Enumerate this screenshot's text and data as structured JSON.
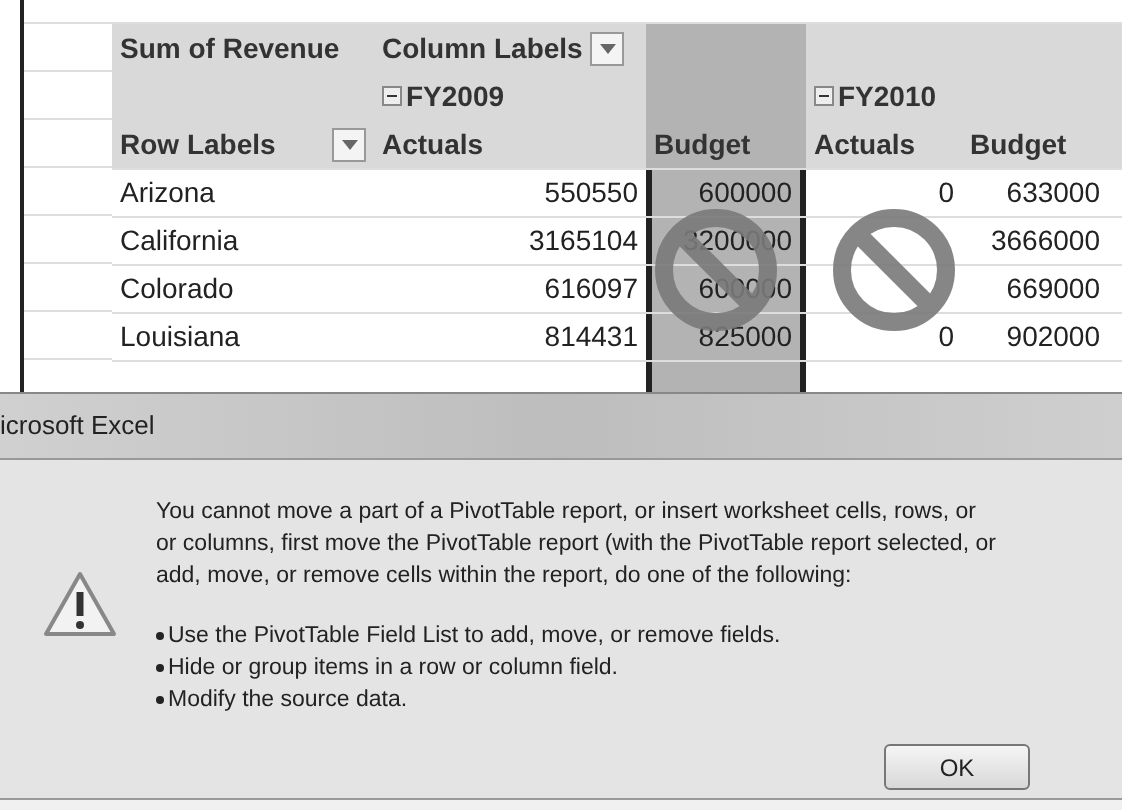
{
  "pivot": {
    "value_label": "Sum of Revenue",
    "column_labels": "Column Labels",
    "row_labels": "Row Labels",
    "years": [
      {
        "label": "FY2009",
        "expanded": true
      },
      {
        "label": "FY2010",
        "expanded": true
      }
    ],
    "measures": [
      {
        "label": "Actuals",
        "selected": false
      },
      {
        "label": "Budget",
        "selected": true
      },
      {
        "label": "Actuals",
        "selected": false
      },
      {
        "label": "Budget",
        "selected": false
      }
    ],
    "rows": [
      {
        "label": "Arizona",
        "fy2009_actuals": "550550",
        "fy2009_budget": "600000",
        "fy2010_actuals": "0",
        "fy2010_budget": "633000"
      },
      {
        "label": "California",
        "fy2009_actuals": "3165104",
        "fy2009_budget": "3200000",
        "fy2010_budget": "3666000"
      },
      {
        "label": "Colorado",
        "fy2009_actuals": "616097",
        "fy2009_budget": "600000",
        "fy2010_budget": "669000"
      },
      {
        "label": "Louisiana",
        "fy2009_actuals": "814431",
        "fy2009_budget": "825000",
        "fy2010_actuals": "0",
        "fy2010_budget": "902000"
      }
    ]
  },
  "dialog": {
    "title": "icrosoft Excel",
    "message": [
      "You cannot move a part of a PivotTable report, or insert worksheet cells, rows, or",
      "or columns, first move the PivotTable report (with the PivotTable report selected, or",
      "add, move, or remove cells within the report, do one of the following:"
    ],
    "bullets": [
      "Use the PivotTable Field List to add, move, or remove fields.",
      "Hide or group items in a row or column field.",
      "Modify the source data."
    ],
    "button": "OK"
  }
}
